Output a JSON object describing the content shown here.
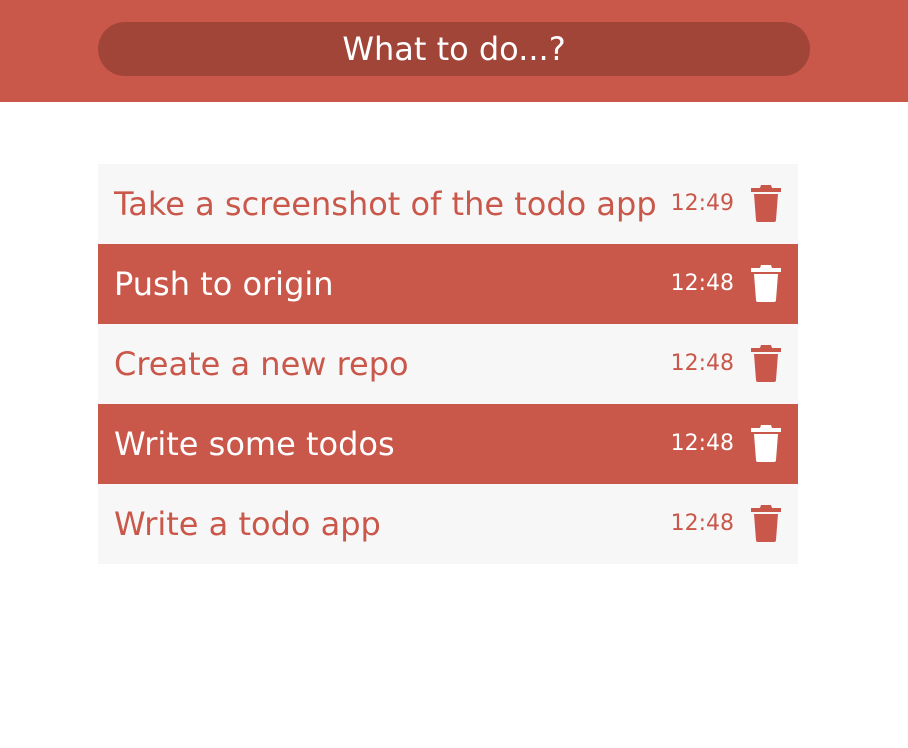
{
  "input": {
    "placeholder": "What to do...?"
  },
  "todos": [
    {
      "text": "Take a screenshot of the todo app",
      "time": "12:49",
      "done": false,
      "delete_icon": "trash-icon"
    },
    {
      "text": "Push to origin",
      "time": "12:48",
      "done": true,
      "delete_icon": "trash-icon"
    },
    {
      "text": "Create a new repo",
      "time": "12:48",
      "done": false,
      "delete_icon": "trash-icon"
    },
    {
      "text": "Write some todos",
      "time": "12:48",
      "done": true,
      "delete_icon": "trash-icon"
    },
    {
      "text": "Write a todo app",
      "time": "12:48",
      "done": false,
      "delete_icon": "trash-icon"
    }
  ],
  "colors": {
    "accent": "#c9574a",
    "input_bg": "#a24539",
    "item_bg": "#f7f7f7",
    "done_text": "#ffffff"
  }
}
